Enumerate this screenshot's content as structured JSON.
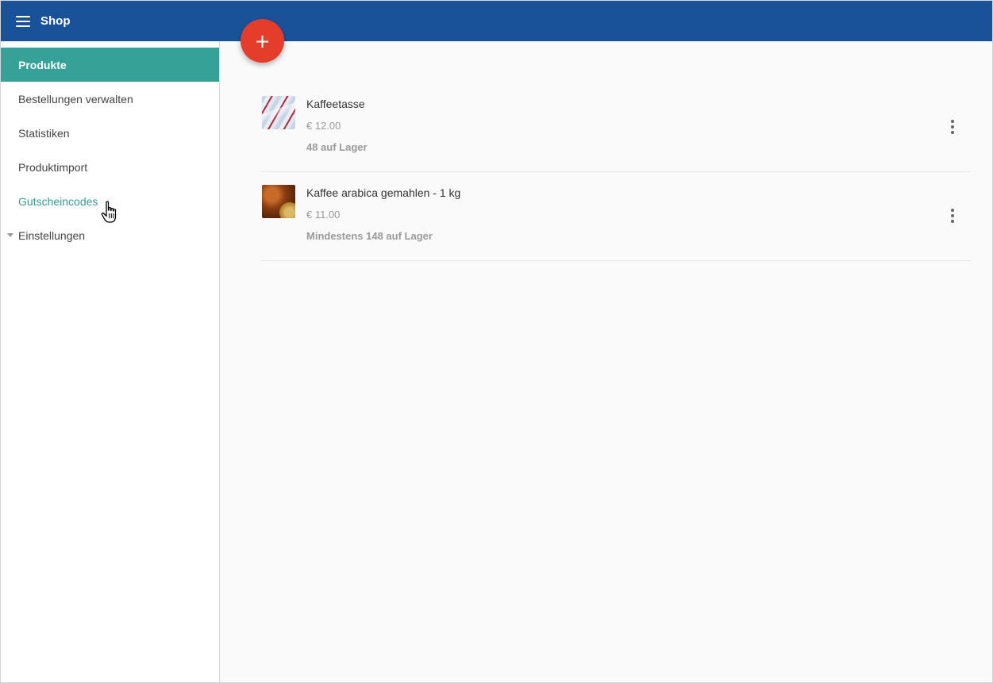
{
  "header": {
    "title": "Shop",
    "menu_icon": "menu-icon"
  },
  "fab": {
    "label": "+",
    "icon": "plus-icon",
    "color": "#e53d2b"
  },
  "sidebar": {
    "items": [
      {
        "label": "Produkte",
        "state": "active"
      },
      {
        "label": "Bestellungen verwalten",
        "state": "normal"
      },
      {
        "label": "Statistiken",
        "state": "normal"
      },
      {
        "label": "Produktimport",
        "state": "normal"
      },
      {
        "label": "Gutscheincodes",
        "state": "hover"
      },
      {
        "label": "Einstellungen",
        "state": "collapsed-group",
        "icon": "caret-down-icon"
      }
    ]
  },
  "products": [
    {
      "name": "Kaffeetasse",
      "price": "€ 12.00",
      "stock": "48 auf Lager",
      "image": "coffee-cup-image"
    },
    {
      "name": "Kaffee arabica gemahlen - 1 kg",
      "price": "€ 11.00",
      "stock": "Mindestens 148 auf Lager",
      "image": "ground-coffee-image"
    }
  ],
  "colors": {
    "header": "#1a529a",
    "active_nav": "#35a197",
    "hover_text": "#3a9a91",
    "fab": "#e53d2b"
  }
}
